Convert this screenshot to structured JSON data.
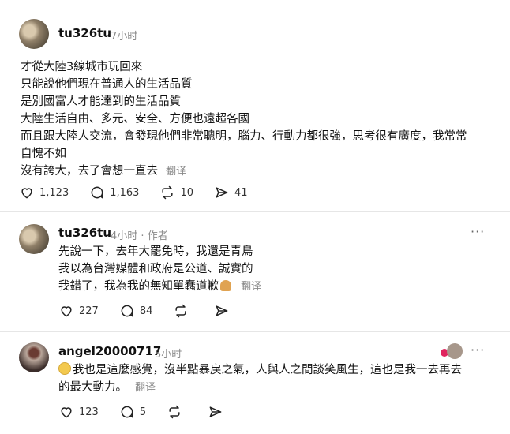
{
  "posts": [
    {
      "username": "tu326tu",
      "time": "7小时",
      "lines": [
        "才從大陸3線城市玩回來",
        "只能說他們現在普通人的生活品質",
        "是別國富人才能達到的生活品質",
        "大陸生活自由、多元、安全、方便也遠超各國",
        "而且跟大陸人交流，會發現他們非常聰明，腦力、行動力都很強，思考很有廣度，我常常",
        "自愧不如",
        "沒有誇大，去了會想一直去"
      ],
      "translate": "翻译",
      "likes": "1,123",
      "comments": "1,163",
      "reposts": "10",
      "shares": "41"
    },
    {
      "username": "tu326tu",
      "time": "4小时",
      "author_tag": "作者",
      "more": "···",
      "lines": [
        "先說一下，去年大罷免時，我還是青鳥",
        "我以為台灣媒體和政府是公道、誠實的",
        "我錯了，我為我的無知單蠢道歉"
      ],
      "translate": "翻译",
      "likes": "227",
      "comments": "84"
    },
    {
      "username": "angel20000717",
      "time": "5小时",
      "more": "···",
      "lines": [
        "我也是這麼感覺，沒半點暴戾之氣，人與人之間談笑風生，這也是我一去再去",
        "的最大動力。"
      ],
      "translate": "翻译",
      "likes": "123",
      "comments": "5"
    }
  ],
  "icons": {
    "like": "heart-icon",
    "comment": "comment-bubble-icon",
    "repost": "repost-arrows-icon",
    "share": "send-paper-plane-icon"
  }
}
